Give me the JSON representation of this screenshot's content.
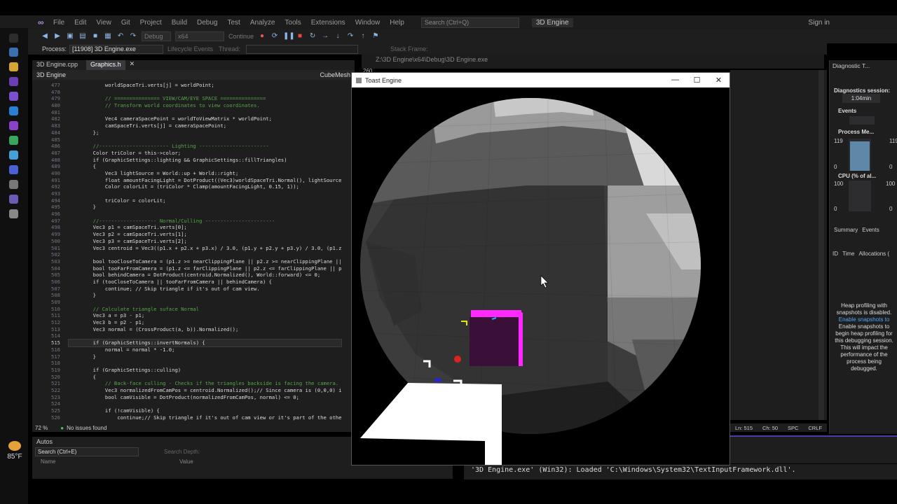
{
  "menu": {
    "items": [
      "File",
      "Edit",
      "View",
      "Git",
      "Project",
      "Build",
      "Debug",
      "Test",
      "Analyze",
      "Tools",
      "Extensions",
      "Window",
      "Help"
    ],
    "search_placeholder": "Search (Ctrl+Q)",
    "solution_title": "3D Engine",
    "sign_in": "Sign in"
  },
  "toolbar": {
    "config": "Debug",
    "platform": "x64",
    "continue_label": "Continue"
  },
  "process_bar": {
    "label": "Process:",
    "process_value": "[11908] 3D Engine.exe",
    "lifecycle": "Lifecycle Events",
    "thread": "Thread:",
    "stack_frame": "Stack Frame:"
  },
  "taskbar": {
    "temperature": "85°F"
  },
  "editor": {
    "tabs": [
      "3D Engine.cpp",
      "Graphics.h"
    ],
    "active_tab": "Graphics.h",
    "nav_project": "3D Engine",
    "nav_symbol": "CubeMesh",
    "zoom": "72 %",
    "issues": "No issues found",
    "current_line": "515",
    "lines": [
      {
        "n": "477",
        "code": "            worldSpaceTri.verts[j] = worldPoint;"
      },
      {
        "n": "478",
        "code": ""
      },
      {
        "n": "479",
        "code": "            // =============== VIEW/CAM/EYE SPACE ===============",
        "cls": "c-com"
      },
      {
        "n": "480",
        "code": "            // Transform world coordinates to view coordinates.",
        "cls": "c-com"
      },
      {
        "n": "481",
        "code": ""
      },
      {
        "n": "482",
        "code": "            Vec4 cameraSpacePoint = worldToViewMatrix * worldPoint;"
      },
      {
        "n": "483",
        "code": "            camSpaceTri.verts[j] = cameraSpacePoint;"
      },
      {
        "n": "484",
        "code": "        };"
      },
      {
        "n": "485",
        "code": ""
      },
      {
        "n": "486",
        "code": "        //----------------------- Lighting -----------------------",
        "cls": "c-com"
      },
      {
        "n": "487",
        "code": "        Color triColor = this->color;"
      },
      {
        "n": "488",
        "code": "        if (GraphicSettings::lighting && GraphicSettings::fillTriangles)"
      },
      {
        "n": "489",
        "code": "        {"
      },
      {
        "n": "490",
        "code": "            Vec3 lightSource = World::up + World::right;"
      },
      {
        "n": "491",
        "code": "            float amountFacingLight = DotProduct((Vec3)worldSpaceTri.Normal(), lightSource"
      },
      {
        "n": "492",
        "code": "            Color colorLit = (triColor * Clamp(amountFacingLight, 0.15, 1));"
      },
      {
        "n": "493",
        "code": ""
      },
      {
        "n": "494",
        "code": "            triColor = colorLit;"
      },
      {
        "n": "495",
        "code": "        }"
      },
      {
        "n": "496",
        "code": ""
      },
      {
        "n": "497",
        "code": "        //------------------- Normal/Culling -----------------------",
        "cls": "c-com"
      },
      {
        "n": "498",
        "code": "        Vec3 p1 = camSpaceTri.verts[0];"
      },
      {
        "n": "499",
        "code": "        Vec3 p2 = camSpaceTri.verts[1];"
      },
      {
        "n": "500",
        "code": "        Vec3 p3 = camSpaceTri.verts[2];"
      },
      {
        "n": "501",
        "code": "        Vec3 centroid = Vec3((p1.x + p2.x + p3.x) / 3.0, (p1.y + p2.y + p3.y) / 3.0, (p1.z"
      },
      {
        "n": "502",
        "code": ""
      },
      {
        "n": "503",
        "code": "        bool tooCloseToCamera = (p1.z >= nearClippingPlane || p2.z >= nearClippingPlane ||"
      },
      {
        "n": "504",
        "code": "        bool tooFarFromCamera = (p1.z <= farClippingPlane || p2.z <= farClippingPlane || p"
      },
      {
        "n": "505",
        "code": "        bool behindCamera = DotProduct(centroid.Normalized(), World::forward) <= 0;"
      },
      {
        "n": "506",
        "code": "        if (tooCloseToCamera || tooFarFromCamera || behindCamera) {"
      },
      {
        "n": "507",
        "code": "            continue; // Skip triangle if it's out of cam view."
      },
      {
        "n": "508",
        "code": "        }"
      },
      {
        "n": "509",
        "code": ""
      },
      {
        "n": "510",
        "code": "        // Calculate triangle suface Normal",
        "cls": "c-com"
      },
      {
        "n": "511",
        "code": "        Vec3 a = p3 - p1;"
      },
      {
        "n": "512",
        "code": "        Vec3 b = p2 - p1;"
      },
      {
        "n": "513",
        "code": "        Vec3 normal = (CrossProduct(a, b)).Normalized();"
      },
      {
        "n": "514",
        "code": ""
      },
      {
        "n": "515",
        "code": "        if (GraphicSettings::invertNormals) {",
        "cls": "c-cur"
      },
      {
        "n": "516",
        "code": "            normal = normal * -1.0;"
      },
      {
        "n": "517",
        "code": "        }"
      },
      {
        "n": "518",
        "code": ""
      },
      {
        "n": "519",
        "code": "        if (GraphicSettings::culling)"
      },
      {
        "n": "520",
        "code": "        {"
      },
      {
        "n": "521",
        "code": "            // Back-face culling - Checks if the triangles backside is facing the camera.",
        "cls": "c-com"
      },
      {
        "n": "522",
        "code": "            Vec3 normalizedFromCamPos = centroid.Normalized();// Since camera is (0,0,0) i"
      },
      {
        "n": "523",
        "code": "            bool camVisible = DotProduct(normalizedFromCamPos, normal) <= 0;"
      },
      {
        "n": "524",
        "code": ""
      },
      {
        "n": "525",
        "code": "            if (!camVisible) {"
      },
      {
        "n": "526",
        "code": "                continue;// Skip triangle if it's out of cam view or it's part of the othe"
      }
    ]
  },
  "status_right": {
    "line": "Ln: 515",
    "col": "Ch: 50",
    "spc": "SPC",
    "eol": "CRLF"
  },
  "autos": {
    "title": "Autos",
    "search_placeholder": "Search (Ctrl+E)",
    "search_depth": "Search Depth:",
    "col_name": "Name",
    "col_value": "Value"
  },
  "console_bg": {
    "path": "Z:\\3D Engine\\x64\\Debug\\3D Engine.exe",
    "number": "260"
  },
  "engine_window": {
    "title": "Toast Engine"
  },
  "output": {
    "line1": "'3D Engine.exe' (Win32): Loaded 'C:\\Windows\\System32\\TextInputFramework.dll'.",
    "line0": "ll'."
  },
  "diagnostics": {
    "title": "Diagnostic T...",
    "session_label": "Diagnostics session:",
    "session_time": "1:04min",
    "events_label": "Events",
    "process_memory_label": "Process Me...",
    "mem_max": "119",
    "mem_min": "0",
    "cpu_label": "CPU (% of al...",
    "cpu_max": "100",
    "cpu_min": "0",
    "tabs": [
      "Summary",
      "Events"
    ],
    "columns": [
      "ID",
      "Time",
      "Allocations ("
    ],
    "heap_text": "Heap profiling with snapshots is disabled.",
    "heap_link": "Enable snapshots to",
    "heap_detail": "Enable snapshots to begin heap profiling for this debugging session. This will impact the performance of the process being debugged."
  }
}
